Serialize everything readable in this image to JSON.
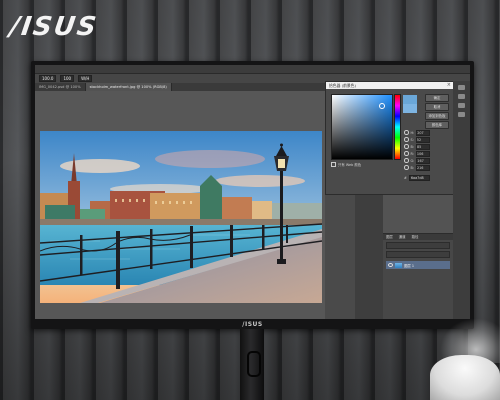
{
  "brand": {
    "logo": "/ISUS",
    "monitor_logo": "/ISUS"
  },
  "photoshop": {
    "options_bar": {
      "field1": "100.0",
      "field2": "100",
      "field3": "W/H"
    },
    "document_tabs": [
      {
        "label": "IMG_0042.psd @ 100%",
        "active": false
      },
      {
        "label": "stockholm_waterfront.jpg @ 100% (RGB/8)",
        "active": true
      }
    ],
    "color_picker": {
      "title": "拾色器 (前景色)",
      "buttons": [
        "确定",
        "取消",
        "添加到色板",
        "颜色库"
      ],
      "fields": [
        {
          "label": "H:",
          "value": "207"
        },
        {
          "label": "S:",
          "value": "52"
        },
        {
          "label": "B:",
          "value": "85"
        },
        {
          "label": "R:",
          "value": "106"
        },
        {
          "label": "G:",
          "value": "167"
        },
        {
          "label": "B:",
          "value": "216"
        }
      ],
      "hex_label": "#",
      "hex_value": "6aa7d8",
      "web_only": "只有 Web 颜色"
    },
    "layers_panel": {
      "tabs": [
        "图层",
        "通道",
        "路径"
      ],
      "layer_name": "图层 1"
    }
  },
  "colors": {
    "wall": "#3a3b3d",
    "bezel": "#141415",
    "ps_bg": "#535353",
    "foreground_color": "#6aa7d8"
  }
}
